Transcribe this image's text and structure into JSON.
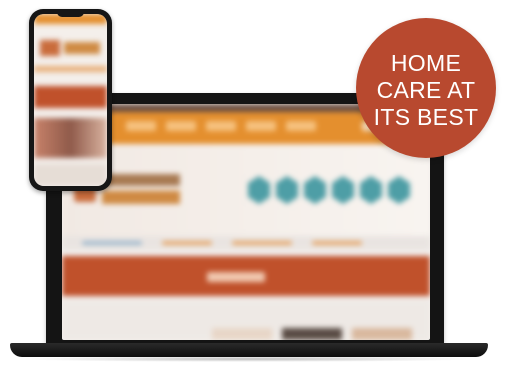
{
  "promo_badge": {
    "lines": [
      "HOME",
      "CARE AT",
      "ITS BEST"
    ],
    "background_color": "#b8492f",
    "text_color": "#ffffff"
  },
  "laptop": {
    "screen_content": "blurred-website-preview",
    "accent_colors": [
      "#e48f2e",
      "#c0512b",
      "#4e9ea6",
      "#6b4f43"
    ]
  },
  "phone": {
    "screen_content": "blurred-mobile-website-preview"
  }
}
